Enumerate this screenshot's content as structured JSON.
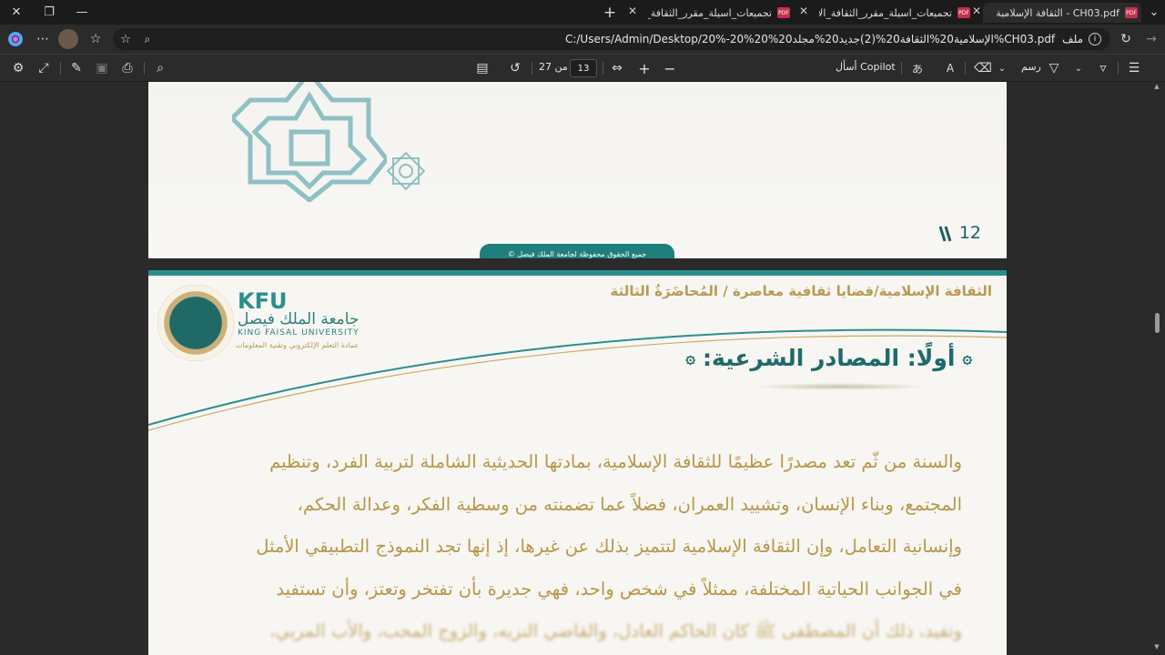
{
  "window": {
    "tabs": [
      {
        "title": "CH03.pdf - الثقافة الإسلامية",
        "active": true
      },
      {
        "title": "تجميعات_اسيلة_مقرر_الثقافة_الاسلا",
        "active": false
      },
      {
        "title": "تجميعات_اسيلة_مقرر_الثقافة_الاسلا",
        "active": false
      }
    ],
    "pdf_badge": "PDF"
  },
  "address": {
    "label": "ملف",
    "url": "C:/Users/Admin/Desktop/20%-20%20%الإسلامية20%الثقافة20%(2)جديد20%مجلد20%CH03.pdf"
  },
  "toolbar": {
    "page_current": "13",
    "page_total_label": "من 27",
    "ask_copilot": "أسأل Copilot",
    "draw": "رسم"
  },
  "page1": {
    "page_number": "12",
    "copyright": "جميع الحقوق محفوظة لجامعة الملك فيصل ©"
  },
  "page2": {
    "header_course": "الثقافة الإسلامية/قضايا ثقافية معاصرة /",
    "header_lecture": "المُحاضَرَةُ الثالثة",
    "logo": {
      "abbr": "KFU",
      "arabic": "جامعة الملك فيصل",
      "english": "KING FAISAL UNIVERSITY",
      "dept": "عمادة التعلم الإلكتروني وتقنية المعلومات"
    },
    "section_title": "أولًا: المصادر الشرعية:",
    "ornament": "۞",
    "body_lines": [
      "والسنة من ثّم تعد مصدرًا عظيمًا للثقافة الإسلامية، بمادتها الحديثية الشاملة لتربية الفرد، وتنظيم",
      "المجتمع، وبناء الإنسان، وتشييد العمران، فضلاً عما تضمنته من وسطية الفكر، وعدالة الحكم،",
      "وإنسانية التعامل، وإن الثقافة الإسلامية لتتميز بذلك عن غيرها، إذ إنها تجد النموذج التطبيقي الأمثل",
      "في الجوانب الحياتية المختلفة، ممثلاً في شخص واحد، فهي جديرة بأن تفتخر وتعتز، وأن تستفيد",
      "وتفيد، ذلك أن المصطفى ﷺ كان الحاكم العادل، والقاضي النزيه، والزوج المحب، والأب المربي،"
    ]
  }
}
